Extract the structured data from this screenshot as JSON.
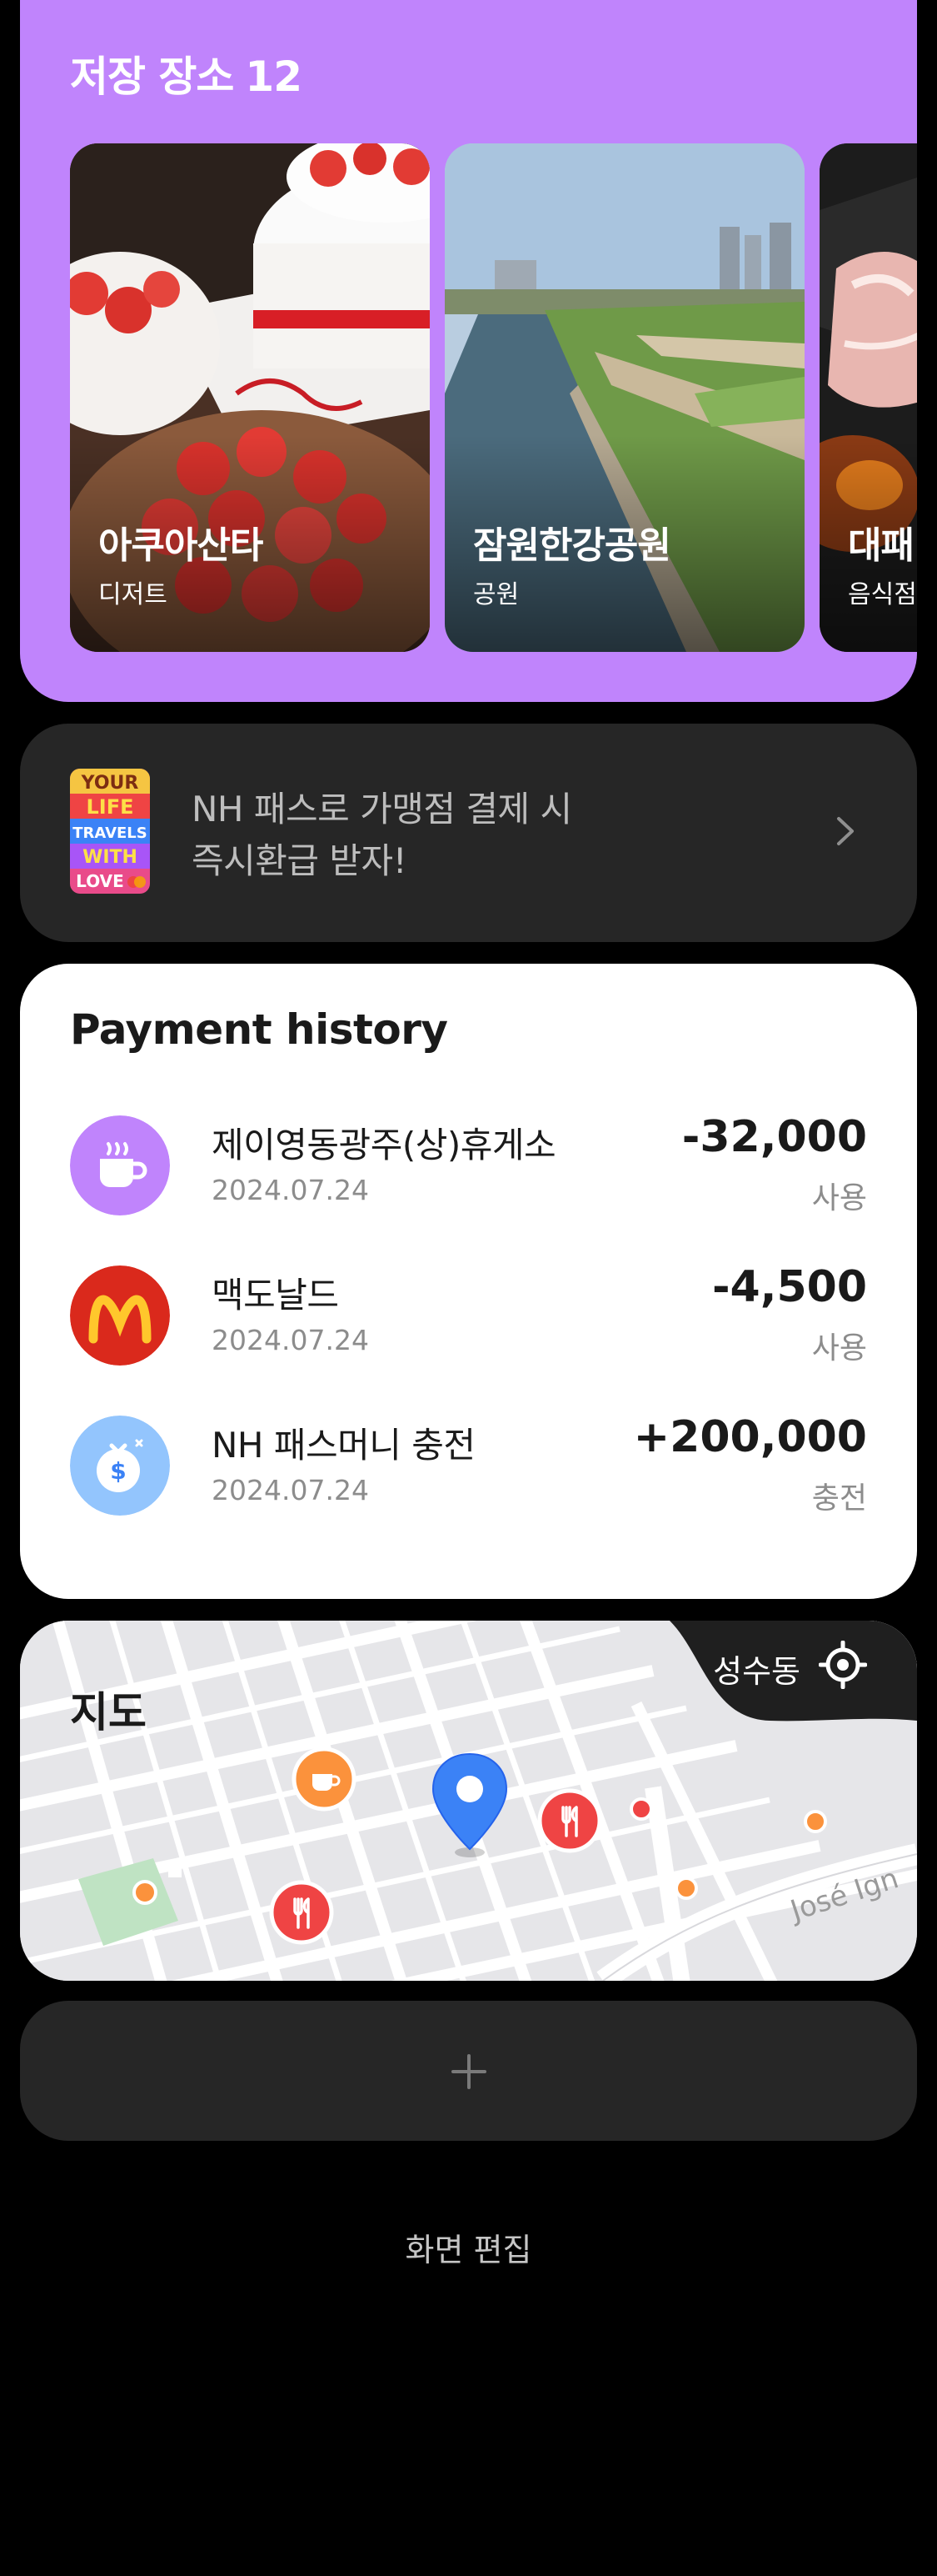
{
  "saved_places": {
    "title": "저장 장소",
    "count": "12",
    "items": [
      {
        "name": "아쿠아산타",
        "category": "디저트"
      },
      {
        "name": "잠원한강공원",
        "category": "공원"
      },
      {
        "name": "대패",
        "category": "음식점"
      }
    ]
  },
  "promo": {
    "line1": "NH 패스로 가맹점 결제 시",
    "line2": "즉시환급 받자!",
    "thumb_words": [
      "YOUR",
      "LIFE",
      "TRAVELS",
      "WITH",
      "LOVE"
    ]
  },
  "payment_history": {
    "title": "Payment history",
    "items": [
      {
        "name": "제이영동광주(상)휴게소",
        "date": "2024.07.24",
        "amount": "-32,000",
        "type": "사용",
        "icon": "coffee-cup-icon",
        "icon_color": "#c084fc"
      },
      {
        "name": "맥도날드",
        "date": "2024.07.24",
        "amount": "-4,500",
        "type": "사용",
        "icon": "mcdonalds-logo-icon",
        "icon_color": "#da291c"
      },
      {
        "name": "NH 패스머니 충전",
        "date": "2024.07.24",
        "amount": "+200,000",
        "type": "충전",
        "icon": "money-bag-icon",
        "icon_color": "#93c5fd"
      }
    ]
  },
  "map": {
    "title": "지도",
    "location": "성수동",
    "street_label": "José Ign"
  },
  "edit_label": "화면 편집",
  "colors": {
    "accent_purple": "#c084fc",
    "card_dark": "#262626",
    "pin_blue": "#3b82f6",
    "marker_red": "#ef4444",
    "marker_orange": "#fb923c"
  }
}
